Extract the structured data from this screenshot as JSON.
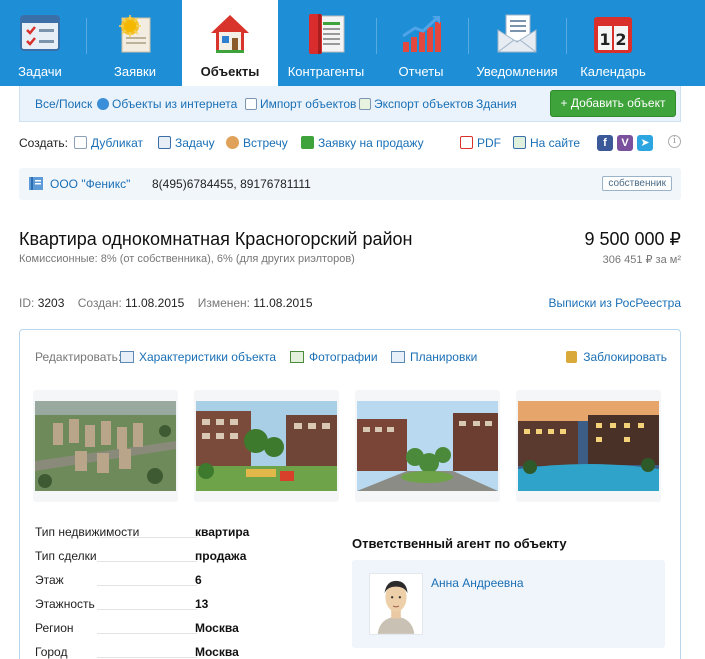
{
  "nav": {
    "items": [
      {
        "label": "Задачи",
        "icon": "tasks-board-icon"
      },
      {
        "label": "Заявки",
        "icon": "requests-icon"
      },
      {
        "label": "Объекты",
        "icon": "house-icon",
        "active": true
      },
      {
        "label": "Контрагенты",
        "icon": "contacts-book-icon"
      },
      {
        "label": "Отчеты",
        "icon": "growth-chart-icon"
      },
      {
        "label": "Уведомления",
        "icon": "notification-letter-icon"
      },
      {
        "label": "Календарь",
        "icon": "calendar-icon"
      }
    ],
    "calendar_day": "12"
  },
  "subbar": {
    "links": [
      "Все/Поиск",
      "Объекты из интернета",
      "Импорт объектов",
      "Экспорт объектов",
      "Здания"
    ],
    "add_button": "+ Добавить объект"
  },
  "create": {
    "label": "Создать:",
    "links": [
      "Дубликат",
      "Задачу",
      "Встречу",
      "Заявку на продажу"
    ],
    "pdf": "PDF",
    "on_site": "На сайте",
    "social": [
      "f",
      "V",
      "➤"
    ],
    "info": "i"
  },
  "owner": {
    "name": "ООО \"Феникс\"",
    "phones": "8(495)6784455, 89176781111",
    "badge": "собственник"
  },
  "listing": {
    "title": "Квартира однокомнатная Красногорский район",
    "commission": "Комиссионные: 8% (от собственника), 6% (для других риэлторов)",
    "price": "9 500 000 ₽",
    "price_per_m2": "306 451 ₽ за м²",
    "id_label": "ID:",
    "id": "3203",
    "created_label": "Создан:",
    "created": "11.08.2015",
    "changed_label": "Изменен:",
    "changed": "11.08.2015",
    "rosreestr_link": "Выписки из РосРеестра"
  },
  "card": {
    "edit_label": "Редактировать:",
    "edit_links": [
      "Характеристики объекта",
      "Фотографии",
      "Планировки"
    ],
    "lock": "Заблокировать",
    "photos": [
      "aerial-view-photo",
      "courtyard-playground-photo",
      "street-boulevard-photo",
      "evening-pool-photo"
    ],
    "properties": [
      {
        "key": "Тип недвижимости",
        "value": "квартира"
      },
      {
        "key": "Тип сделки",
        "value": "продажа"
      },
      {
        "key": "Этаж",
        "value": "6"
      },
      {
        "key": "Этажность",
        "value": "13"
      },
      {
        "key": "Регион",
        "value": "Москва"
      },
      {
        "key": "Город",
        "value": "Москва"
      }
    ],
    "agent_title": "Ответственный агент по объекту",
    "agent_name": "Анна Андреевна"
  },
  "colors": {
    "nav_bg": "#1e8fd6",
    "link": "#1a6fb5",
    "add_button": "#3ea33a",
    "card_border": "#b8d7ee"
  }
}
